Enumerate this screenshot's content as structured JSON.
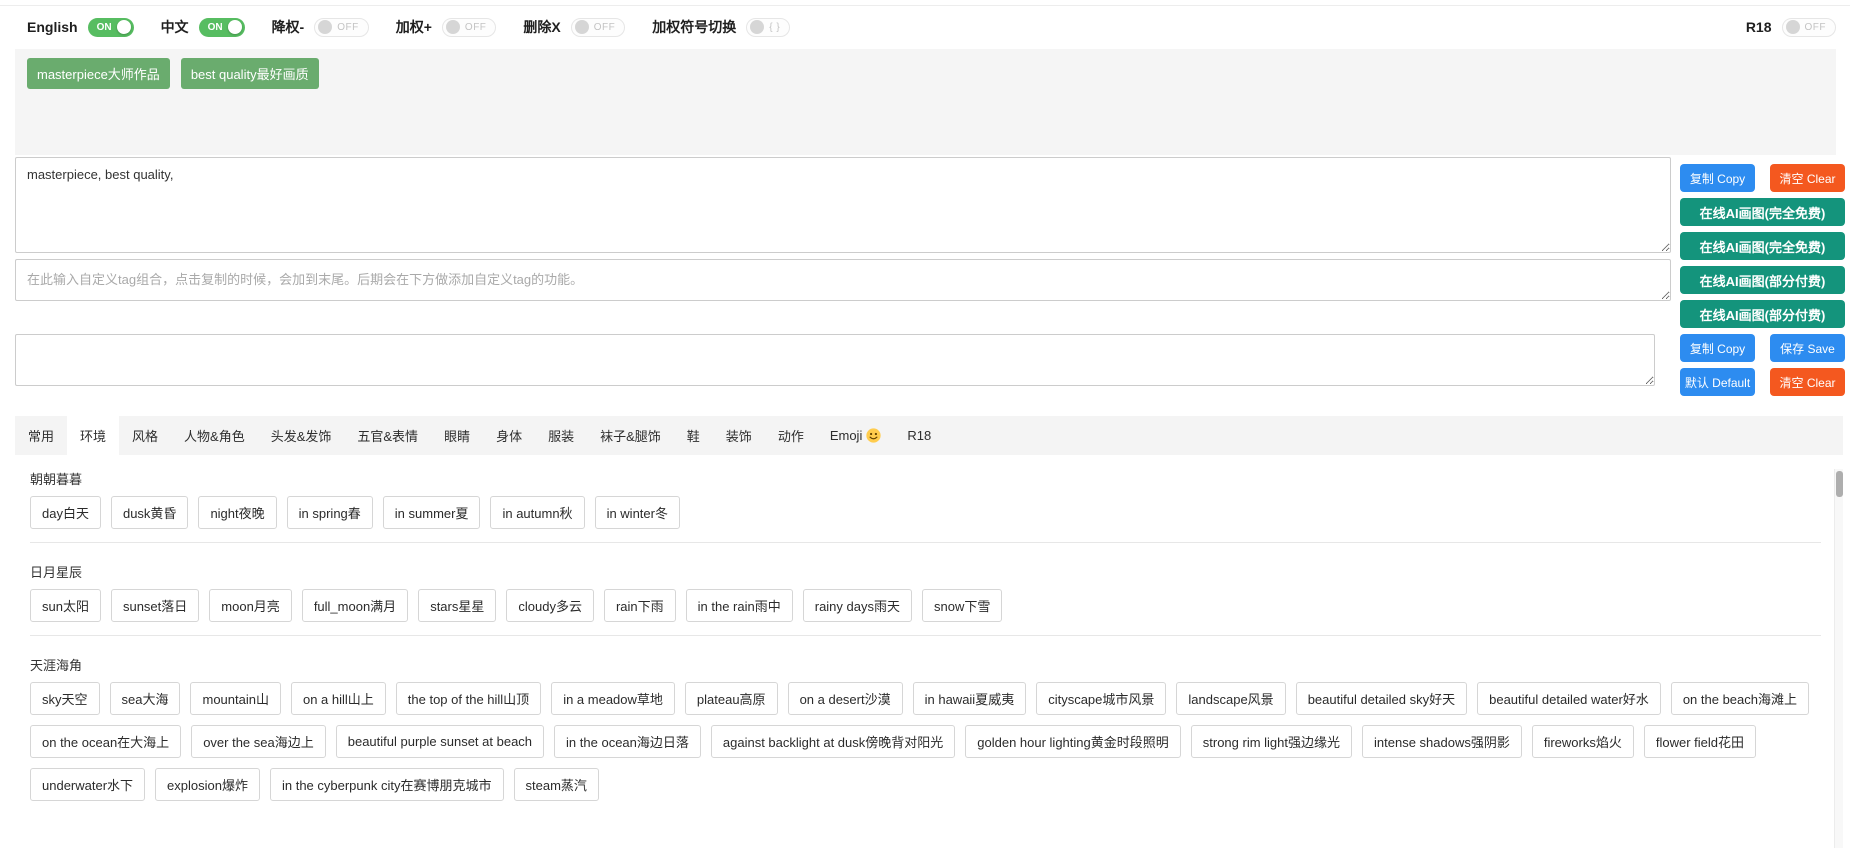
{
  "colors": {
    "primary_blue": "#2d8cf0",
    "danger_orange": "#f4581f",
    "teal": "#14947c",
    "toggle_green": "#57bd61",
    "chip_green": "#6aac6e"
  },
  "toolbar": {
    "toggles": [
      {
        "name": "english",
        "label": "English",
        "state": "on",
        "text": "ON"
      },
      {
        "name": "chinese",
        "label": "中文",
        "state": "on",
        "text": "ON"
      },
      {
        "name": "lower-weight",
        "label": "降权-",
        "state": "off",
        "text": "OFF"
      },
      {
        "name": "add-weight",
        "label": "加权+",
        "state": "off",
        "text": "OFF"
      },
      {
        "name": "delete-x",
        "label": "删除X",
        "state": "off",
        "text": "OFF"
      },
      {
        "name": "weight-symbol",
        "label": "加权符号切换",
        "state": "off",
        "text": "{ }"
      },
      {
        "name": "r18",
        "label": "R18",
        "state": "off",
        "text": "OFF",
        "align": "right"
      }
    ]
  },
  "selected_tags": [
    "masterpiece大师作品",
    "best quality最好画质"
  ],
  "prompt": {
    "value": "masterpiece, best quality,"
  },
  "custom_input": {
    "placeholder": "在此输入自定义tag组合，点击复制的时候，会加到末尾。后期会在下方做添加自定义tag的功能。"
  },
  "saved_input": {
    "value": ""
  },
  "action_rows": [
    [
      {
        "name": "copy-prompt",
        "label": "复制 Copy",
        "color": "blue"
      },
      {
        "name": "clear-prompt",
        "label": "清空 Clear",
        "color": "orange"
      }
    ],
    [
      {
        "name": "online-ai-free-1",
        "label": "在线AI画图(完全免费)",
        "color": "teal"
      }
    ],
    [
      {
        "name": "online-ai-free-2",
        "label": "在线AI画图(完全免费)",
        "color": "teal"
      }
    ],
    [
      {
        "name": "online-ai-paid-1",
        "label": "在线AI画图(部分付费)",
        "color": "teal"
      }
    ],
    [
      {
        "name": "online-ai-paid-2",
        "label": "在线AI画图(部分付费)",
        "color": "teal"
      }
    ],
    [
      {
        "name": "copy-custom",
        "label": "复制 Copy",
        "color": "blue"
      },
      {
        "name": "save-custom",
        "label": "保存 Save",
        "color": "blue"
      }
    ],
    [
      {
        "name": "default-custom",
        "label": "默认 Default",
        "color": "blue"
      },
      {
        "name": "clear-custom",
        "label": "清空 Clear",
        "color": "orange"
      }
    ]
  ],
  "tabs": {
    "active_index": 1,
    "items": [
      {
        "name": "common",
        "label": "常用"
      },
      {
        "name": "environment",
        "label": "环境"
      },
      {
        "name": "style",
        "label": "风格"
      },
      {
        "name": "character",
        "label": "人物&角色"
      },
      {
        "name": "hair",
        "label": "头发&发饰"
      },
      {
        "name": "face-expression",
        "label": "五官&表情"
      },
      {
        "name": "eyes",
        "label": "眼睛"
      },
      {
        "name": "body",
        "label": "身体"
      },
      {
        "name": "clothing",
        "label": "服装"
      },
      {
        "name": "socks-legwear",
        "label": "袜子&腿饰"
      },
      {
        "name": "shoes",
        "label": "鞋"
      },
      {
        "name": "accessories",
        "label": "装饰"
      },
      {
        "name": "action",
        "label": "动作"
      },
      {
        "name": "emoji",
        "label": "Emoji",
        "icon": "smiley"
      },
      {
        "name": "r18",
        "label": "R18"
      }
    ]
  },
  "sections": [
    {
      "name": "morning-evening",
      "title": "朝朝暮暮",
      "tags": [
        "day白天",
        "dusk黄昏",
        "night夜晚",
        "in spring春",
        "in summer夏",
        "in autumn秋",
        "in winter冬"
      ]
    },
    {
      "name": "sun-moon-stars",
      "title": "日月星辰",
      "tags": [
        "sun太阳",
        "sunset落日",
        "moon月亮",
        "full_moon满月",
        "stars星星",
        "cloudy多云",
        "rain下雨",
        "in the rain雨中",
        "rainy days雨天",
        "snow下雪"
      ]
    },
    {
      "name": "landscape",
      "title": "天涯海角",
      "tags": [
        "sky天空",
        "sea大海",
        "mountain山",
        "on a hill山上",
        "the top of the hill山顶",
        "in a meadow草地",
        "plateau高原",
        "on a desert沙漠",
        "in hawaii夏威夷",
        "cityscape城市风景",
        "landscape风景",
        "beautiful detailed sky好天",
        "beautiful detailed water好水",
        "on the beach海滩上",
        "on the ocean在大海上",
        "over the sea海边上",
        "beautiful purple sunset at beach",
        "in the ocean海边日落",
        "against backlight at dusk傍晚背对阳光",
        "golden hour lighting黄金时段照明",
        "strong rim light强边缘光",
        "intense shadows强阴影",
        "fireworks焰火",
        "flower field花田",
        "underwater水下",
        "explosion爆炸",
        "in the cyberpunk city在赛博朋克城市",
        "steam蒸汽"
      ]
    }
  ]
}
